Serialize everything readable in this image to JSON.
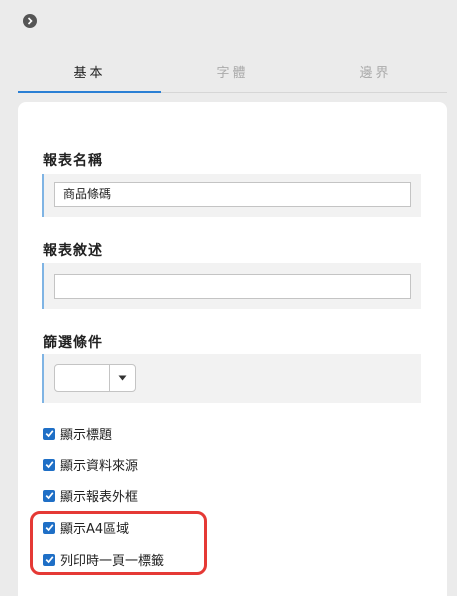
{
  "tabs": [
    {
      "label": "基本",
      "active": true
    },
    {
      "label": "字體",
      "active": false
    },
    {
      "label": "邊界",
      "active": false
    }
  ],
  "report_name": {
    "label": "報表名稱",
    "value": "商品條碼"
  },
  "report_desc": {
    "label": "報表敘述",
    "value": ""
  },
  "filter": {
    "label": "篩選條件",
    "selected": ""
  },
  "checkboxes": [
    {
      "label": "顯示標題",
      "checked": true
    },
    {
      "label": "顯示資料來源",
      "checked": true
    },
    {
      "label": "顯示報表外框",
      "checked": true
    },
    {
      "label": "顯示A4區域",
      "checked": true
    },
    {
      "label": "列印時一頁一標籤",
      "checked": true
    }
  ],
  "colors": {
    "accent": "#2a7fd4",
    "checkbox": "#1f6fc6",
    "highlight": "#e53935"
  },
  "icons": {
    "collapse": "chevron-right-circle-icon",
    "dropdown": "caret-down-icon",
    "check": "checkmark-icon"
  }
}
